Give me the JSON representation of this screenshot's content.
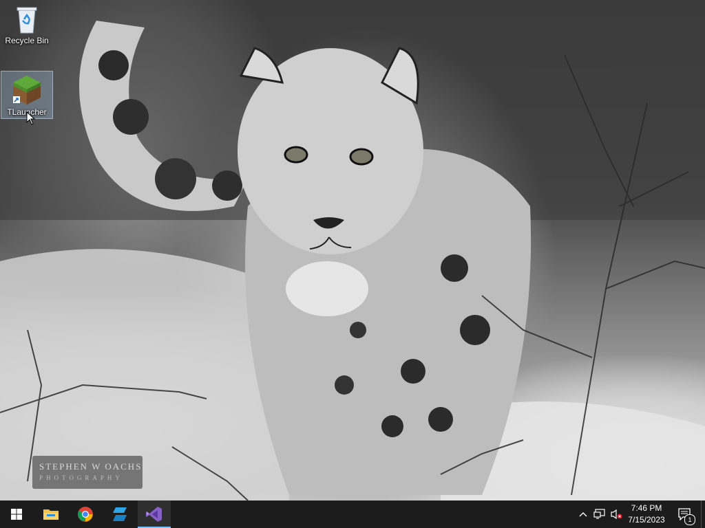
{
  "desktop": {
    "icons": [
      {
        "name": "recycle-bin",
        "label": "Recycle Bin"
      },
      {
        "name": "tlauncher",
        "label": "TLauncher"
      }
    ],
    "wallpaper_watermark": {
      "line1": "STEPHEN W OACHS",
      "line2": "PHOTOGRAPHY"
    }
  },
  "taskbar": {
    "pinned": [
      {
        "name": "start-button",
        "icon": "windows-logo-icon"
      },
      {
        "name": "file-explorer",
        "icon": "folder-icon"
      },
      {
        "name": "chrome",
        "icon": "chrome-icon"
      },
      {
        "name": "app",
        "icon": "app-icon"
      },
      {
        "name": "visual-studio",
        "icon": "visual-studio-icon",
        "active": true
      }
    ],
    "tray": {
      "time": "7:46 PM",
      "date": "7/15/2023",
      "notification_count": "1"
    }
  },
  "colors": {
    "taskbar_bg": "#1c1c1c",
    "active_indicator": "#7cc2ff",
    "selection_bg": "#a0bedc"
  }
}
